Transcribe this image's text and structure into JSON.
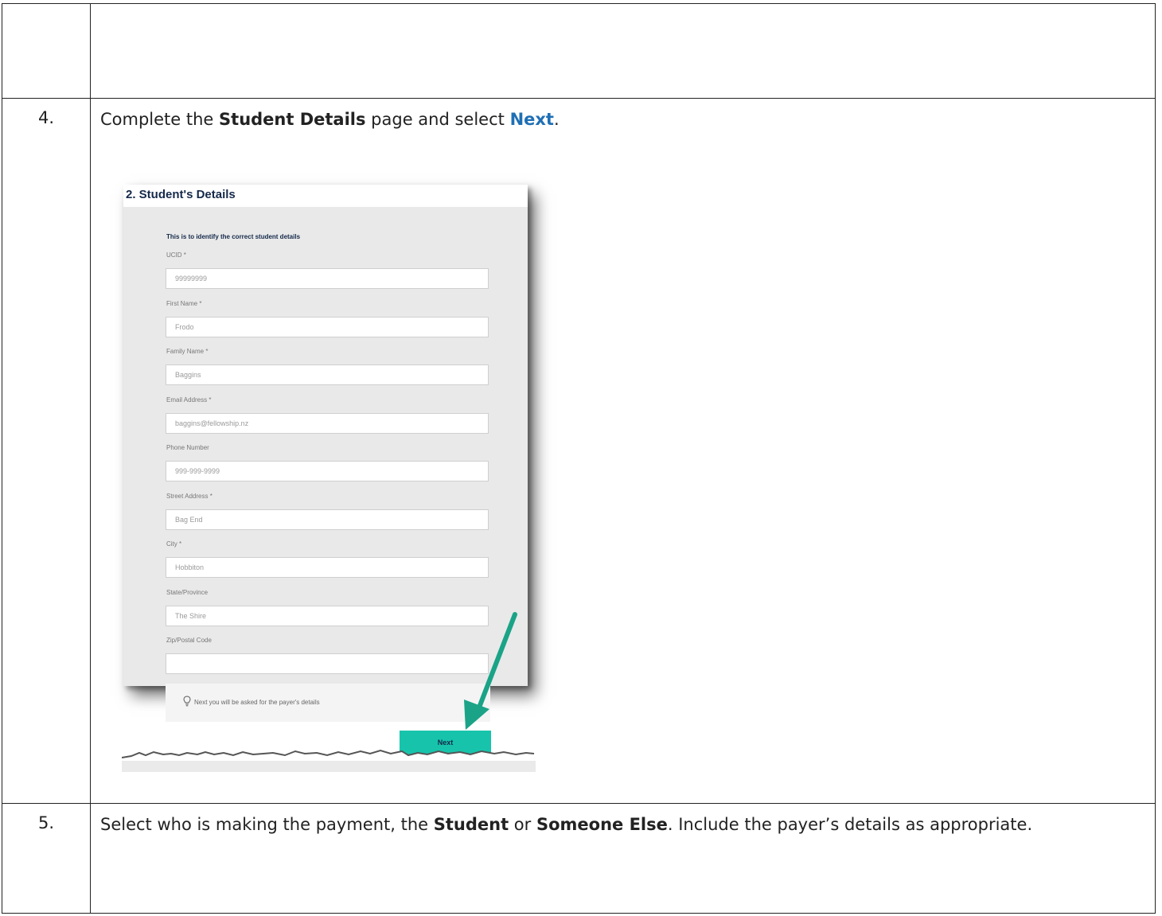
{
  "steps": [
    {
      "number": "",
      "text": ""
    },
    {
      "number": "4.",
      "text_prefix": "Complete the ",
      "bold": "Student Details",
      "text_mid": " page and select ",
      "link": "Next",
      "text_suffix": "."
    },
    {
      "number": "5.",
      "text_prefix": "Select who is making the payment, the ",
      "bold1": "Student",
      "text_mid": " or ",
      "bold2": "Someone Else",
      "text_suffix": ". Include the payer’s details as appropriate."
    }
  ],
  "screenshot": {
    "title": "2. Student's Details",
    "intro": "This is to identify the correct student details",
    "fields": [
      {
        "label": "UCID *",
        "value": "99999999"
      },
      {
        "label": "First Name *",
        "value": "Frodo"
      },
      {
        "label": "Family Name *",
        "value": "Baggins"
      },
      {
        "label": "Email Address *",
        "value": "baggins@fellowship.nz"
      },
      {
        "label": "Phone Number",
        "value": "999-999-9999"
      },
      {
        "label": "Street Address *",
        "value": "Bag End"
      },
      {
        "label": "City *",
        "value": "Hobbiton"
      },
      {
        "label": "State/Province",
        "value": "The Shire"
      },
      {
        "label": "Zip/Postal Code",
        "value": ""
      }
    ],
    "info_text": "Next you will be asked for the payer's details",
    "next_label": "Next",
    "accent_color": "#17c4ab",
    "arrow_color": "#1aa387"
  }
}
